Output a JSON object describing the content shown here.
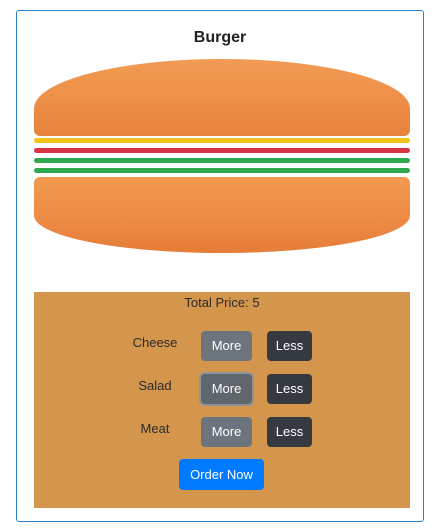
{
  "burger": {
    "title": "Burger",
    "layers": [
      {
        "name": "cheese",
        "color": "#f2c216"
      },
      {
        "name": "meat",
        "color": "#d93544"
      },
      {
        "name": "salad",
        "color": "#2fa84f"
      },
      {
        "name": "salad",
        "color": "#2fa84f"
      }
    ]
  },
  "controls": {
    "price_text": "Total Price: 5",
    "rows": [
      {
        "label": "Cheese",
        "more": "More",
        "less": "Less"
      },
      {
        "label": "Salad",
        "more": "More",
        "less": "Less"
      },
      {
        "label": "Meat",
        "more": "More",
        "less": "Less"
      }
    ],
    "order_label": "Order Now"
  },
  "colors": {
    "bun": "#ec8a43",
    "panel": "#d4954c",
    "more_button": "#6c757d",
    "less_button": "#343a40",
    "order_button": "#007bff",
    "card_border": "#2d7fd0"
  }
}
